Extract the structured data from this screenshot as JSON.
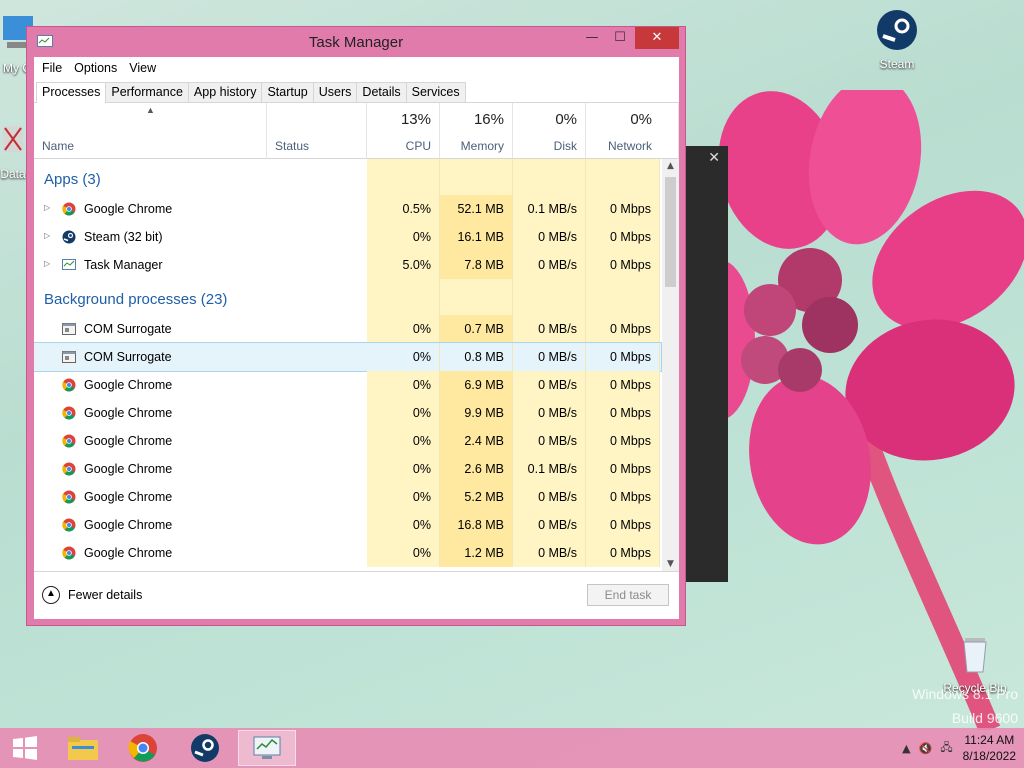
{
  "desktop": {
    "icons": [
      {
        "label": "My C"
      },
      {
        "label": "Data"
      },
      {
        "label": "Steam"
      },
      {
        "label": "Recycle Bin"
      }
    ],
    "watermark_line1": "Windows 8.1 Pro",
    "watermark_line2": "Build 9600"
  },
  "window": {
    "title": "Task Manager",
    "min": "—",
    "max": "☐",
    "close": "✕"
  },
  "menu": [
    "File",
    "Options",
    "View"
  ],
  "tabs": [
    "Processes",
    "Performance",
    "App history",
    "Startup",
    "Users",
    "Details",
    "Services"
  ],
  "columns": {
    "name": "Name",
    "status": "Status",
    "cpu": {
      "pct": "13%",
      "label": "CPU"
    },
    "memory": {
      "pct": "16%",
      "label": "Memory"
    },
    "disk": {
      "pct": "0%",
      "label": "Disk"
    },
    "network": {
      "pct": "0%",
      "label": "Network"
    }
  },
  "groups": {
    "apps": "Apps (3)",
    "background": "Background processes (23)"
  },
  "apps": [
    {
      "name": "Google Chrome",
      "icon": "chrome-icon",
      "cpu": "0.5%",
      "mem": "52.1 MB",
      "disk": "0.1 MB/s",
      "net": "0 Mbps"
    },
    {
      "name": "Steam (32 bit)",
      "icon": "steam-icon",
      "cpu": "0%",
      "mem": "16.1 MB",
      "disk": "0 MB/s",
      "net": "0 Mbps"
    },
    {
      "name": "Task Manager",
      "icon": "task-manager-icon",
      "cpu": "5.0%",
      "mem": "7.8 MB",
      "disk": "0 MB/s",
      "net": "0 Mbps"
    }
  ],
  "background": [
    {
      "name": "COM Surrogate",
      "icon": "com-icon",
      "cpu": "0%",
      "mem": "0.7 MB",
      "disk": "0 MB/s",
      "net": "0 Mbps"
    },
    {
      "name": "COM Surrogate",
      "icon": "com-icon",
      "cpu": "0%",
      "mem": "0.8 MB",
      "disk": "0 MB/s",
      "net": "0 Mbps"
    },
    {
      "name": "Google Chrome",
      "icon": "chrome-icon",
      "cpu": "0%",
      "mem": "6.9 MB",
      "disk": "0 MB/s",
      "net": "0 Mbps"
    },
    {
      "name": "Google Chrome",
      "icon": "chrome-icon",
      "cpu": "0%",
      "mem": "9.9 MB",
      "disk": "0 MB/s",
      "net": "0 Mbps"
    },
    {
      "name": "Google Chrome",
      "icon": "chrome-icon",
      "cpu": "0%",
      "mem": "2.4 MB",
      "disk": "0 MB/s",
      "net": "0 Mbps"
    },
    {
      "name": "Google Chrome",
      "icon": "chrome-icon",
      "cpu": "0%",
      "mem": "2.6 MB",
      "disk": "0.1 MB/s",
      "net": "0 Mbps"
    },
    {
      "name": "Google Chrome",
      "icon": "chrome-icon",
      "cpu": "0%",
      "mem": "5.2 MB",
      "disk": "0 MB/s",
      "net": "0 Mbps"
    },
    {
      "name": "Google Chrome",
      "icon": "chrome-icon",
      "cpu": "0%",
      "mem": "16.8 MB",
      "disk": "0 MB/s",
      "net": "0 Mbps"
    },
    {
      "name": "Google Chrome",
      "icon": "chrome-icon",
      "cpu": "0%",
      "mem": "1.2 MB",
      "disk": "0 MB/s",
      "net": "0 Mbps"
    }
  ],
  "footer": {
    "fewer_details": "Fewer details",
    "end_task": "End task"
  },
  "taskbar": {
    "time": "11:24 AM",
    "date": "8/18/2022"
  },
  "colors": {
    "window_border": "#e17bab",
    "group_heading": "#1e5fa8",
    "close_button": "#c7383a"
  }
}
